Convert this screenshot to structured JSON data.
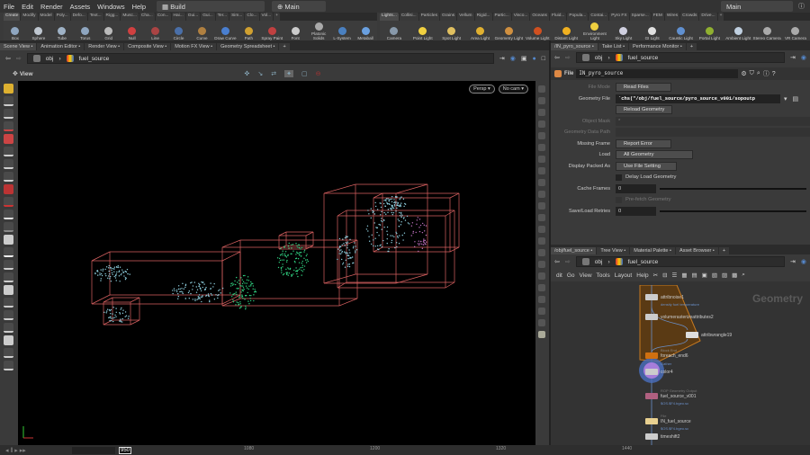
{
  "menubar": {
    "items": [
      "File",
      "Edit",
      "Render",
      "Assets",
      "Windows",
      "Help"
    ],
    "desktop": "Build",
    "context": "Main",
    "context_right": "Main"
  },
  "shelf_left": {
    "tabs": [
      "Create",
      "Modify",
      "Model",
      "Poly...",
      "Defo...",
      "Text...",
      "Rigg...",
      "Musc...",
      "Cha...",
      "Con...",
      "Hai...",
      "Gui...",
      "Gui...",
      "Ter...",
      "Sim...",
      "Clo...",
      "Vol..."
    ],
    "tools": [
      {
        "label": "Box",
        "color": "#8fa6c0"
      },
      {
        "label": "Sphere",
        "color": "#bfc7d0"
      },
      {
        "label": "Tube",
        "color": "#9fb2c6"
      },
      {
        "label": "Torus",
        "color": "#8fa6c0"
      },
      {
        "label": "Grid",
        "color": "#bbbbbb"
      },
      {
        "label": "Null",
        "color": "#d04040"
      },
      {
        "label": "Line",
        "color": "#aa4444"
      },
      {
        "label": "Circle",
        "color": "#4a6fa8"
      },
      {
        "label": "Curve",
        "color": "#b08040"
      },
      {
        "label": "Draw Curve",
        "color": "#4a7fd0"
      },
      {
        "label": "Path",
        "color": "#d0a030"
      },
      {
        "label": "Spray Paint",
        "color": "#c04040"
      },
      {
        "label": "Font",
        "color": "#cccccc"
      },
      {
        "label": "Platonic Solids",
        "color": "#aaaaaa"
      },
      {
        "label": "L-System",
        "color": "#4a80c0"
      },
      {
        "label": "Metaball",
        "color": "#6aa0e0"
      }
    ]
  },
  "shelf_right": {
    "tabs": [
      "Lights...",
      "Collisi...",
      "Particles",
      "Grains",
      "Vellum",
      "Rigid...",
      "Partic...",
      "Visco...",
      "Oceans",
      "Fluid...",
      "Popula...",
      "Contai...",
      "Pyro FX",
      "Sparse...",
      "FEM",
      "Wires",
      "Crowds",
      "Drive..."
    ],
    "tools": [
      {
        "label": "Camera",
        "color": "#8899aa"
      },
      {
        "label": "Point Light",
        "color": "#f0d040"
      },
      {
        "label": "Spot Light",
        "color": "#e0c060"
      },
      {
        "label": "Area Light",
        "color": "#e0b030"
      },
      {
        "label": "Geometry Light",
        "color": "#d09040"
      },
      {
        "label": "Volume Light",
        "color": "#d05020"
      },
      {
        "label": "Distant Light",
        "color": "#f0b020"
      },
      {
        "label": "Environment Light",
        "color": "#f0d040"
      },
      {
        "label": "Sky Light",
        "color": "#d0d0e0"
      },
      {
        "label": "GI Light",
        "color": "#e0e0e0"
      },
      {
        "label": "Caustic Light",
        "color": "#6090d0"
      },
      {
        "label": "Portal Light",
        "color": "#90b030"
      },
      {
        "label": "Ambient Light",
        "color": "#c0d0e0"
      },
      {
        "label": "Stereo Camera",
        "color": "#aaaaaa"
      },
      {
        "label": "VR Camera",
        "color": "#aaaaaa"
      }
    ]
  },
  "left_pane": {
    "tabs": [
      "Scene View",
      "Animation Editor",
      "Render View",
      "Composite View",
      "Motion FX View",
      "Geometry Spreadsheet"
    ],
    "path": [
      "obj",
      "fuel_source"
    ],
    "view_label": "View",
    "persp": "Persp",
    "camera": "No cam"
  },
  "params_pane": {
    "tabs": [
      "/IN_pyro_source",
      "Take List",
      "Performance Monitor"
    ],
    "path": [
      "obj",
      "fuel_source"
    ],
    "node_type": "File",
    "node_name": "IN_pyro_source",
    "file_mode_label": "File Mode",
    "file_mode": "Read Files",
    "geometry_file_label": "Geometry File",
    "geometry_file": "`chs(\"/obj/fuel_source/pyro_source_v001/sopoutp",
    "reload": "Reload Geometry",
    "object_mask_label": "Object Mask",
    "object_mask": "*",
    "data_path_label": "Geometry Data Path",
    "missing_frame_label": "Missing Frame",
    "missing_frame": "Report Error",
    "load_label": "Load",
    "load": "All Geometry",
    "packed_label": "Display Packed As",
    "packed": "Use File Setting",
    "delay_load": "Delay Load Geometry",
    "cache_frames_label": "Cache Frames",
    "cache_frames": "0",
    "prefetch": "Pre-fetch Geometry",
    "retries_label": "Save/Load Retries",
    "retries": "0"
  },
  "network_pane": {
    "tabs": [
      "/obj/fuel_source",
      "Tree View",
      "Material Palette",
      "Asset Browser"
    ],
    "path": [
      "obj",
      "fuel_source"
    ],
    "menu": [
      "dit",
      "Go",
      "View",
      "Tools",
      "Layout",
      "Help"
    ],
    "context_label": "Geometry",
    "nodes": [
      {
        "name": "attribnoise1",
        "sub": "density fuel temperature"
      },
      {
        "name": "volumerasterizeattributes2",
        "sub": ""
      },
      {
        "name": "attribwrangle19",
        "sub": ""
      },
      {
        "name": "foreach_end6",
        "sub": "Block End",
        "note": "Gather"
      },
      {
        "name": "color4",
        "sub": ""
      },
      {
        "name": "fuel_source_v001",
        "type": "ROP Geometry Output",
        "sub": "$OS.$F4.bgeo.sc"
      },
      {
        "name": "IN_fuel_source",
        "type": "File",
        "sub": "$OS.$F4.bgeo.sc"
      },
      {
        "name": "timeshift2",
        "sub": ""
      }
    ]
  },
  "timeline": {
    "frame": "950",
    "ticks": [
      "1080",
      "1200",
      "1320",
      "1440"
    ]
  }
}
